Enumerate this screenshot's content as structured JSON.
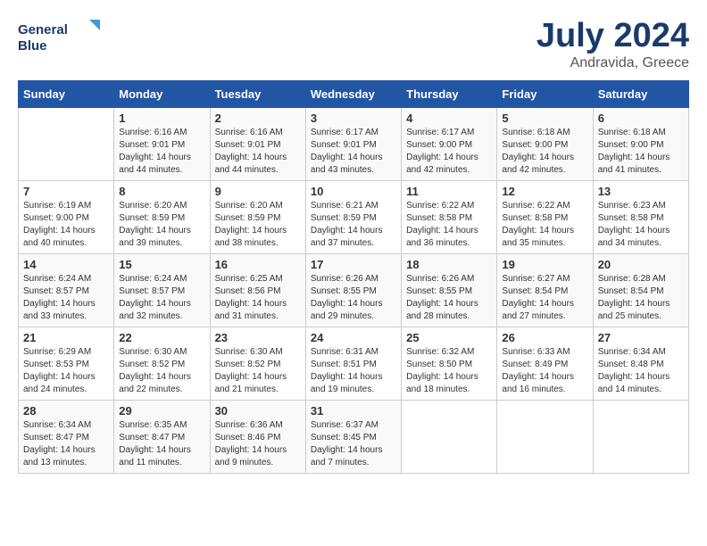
{
  "logo": {
    "line1": "General",
    "line2": "Blue"
  },
  "title": "July 2024",
  "subtitle": "Andravida, Greece",
  "days_of_week": [
    "Sunday",
    "Monday",
    "Tuesday",
    "Wednesday",
    "Thursday",
    "Friday",
    "Saturday"
  ],
  "weeks": [
    [
      {
        "day": "",
        "sunrise": "",
        "sunset": "",
        "daylight": ""
      },
      {
        "day": "1",
        "sunrise": "Sunrise: 6:16 AM",
        "sunset": "Sunset: 9:01 PM",
        "daylight": "Daylight: 14 hours and 44 minutes."
      },
      {
        "day": "2",
        "sunrise": "Sunrise: 6:16 AM",
        "sunset": "Sunset: 9:01 PM",
        "daylight": "Daylight: 14 hours and 44 minutes."
      },
      {
        "day": "3",
        "sunrise": "Sunrise: 6:17 AM",
        "sunset": "Sunset: 9:01 PM",
        "daylight": "Daylight: 14 hours and 43 minutes."
      },
      {
        "day": "4",
        "sunrise": "Sunrise: 6:17 AM",
        "sunset": "Sunset: 9:00 PM",
        "daylight": "Daylight: 14 hours and 42 minutes."
      },
      {
        "day": "5",
        "sunrise": "Sunrise: 6:18 AM",
        "sunset": "Sunset: 9:00 PM",
        "daylight": "Daylight: 14 hours and 42 minutes."
      },
      {
        "day": "6",
        "sunrise": "Sunrise: 6:18 AM",
        "sunset": "Sunset: 9:00 PM",
        "daylight": "Daylight: 14 hours and 41 minutes."
      }
    ],
    [
      {
        "day": "7",
        "sunrise": "Sunrise: 6:19 AM",
        "sunset": "Sunset: 9:00 PM",
        "daylight": "Daylight: 14 hours and 40 minutes."
      },
      {
        "day": "8",
        "sunrise": "Sunrise: 6:20 AM",
        "sunset": "Sunset: 8:59 PM",
        "daylight": "Daylight: 14 hours and 39 minutes."
      },
      {
        "day": "9",
        "sunrise": "Sunrise: 6:20 AM",
        "sunset": "Sunset: 8:59 PM",
        "daylight": "Daylight: 14 hours and 38 minutes."
      },
      {
        "day": "10",
        "sunrise": "Sunrise: 6:21 AM",
        "sunset": "Sunset: 8:59 PM",
        "daylight": "Daylight: 14 hours and 37 minutes."
      },
      {
        "day": "11",
        "sunrise": "Sunrise: 6:22 AM",
        "sunset": "Sunset: 8:58 PM",
        "daylight": "Daylight: 14 hours and 36 minutes."
      },
      {
        "day": "12",
        "sunrise": "Sunrise: 6:22 AM",
        "sunset": "Sunset: 8:58 PM",
        "daylight": "Daylight: 14 hours and 35 minutes."
      },
      {
        "day": "13",
        "sunrise": "Sunrise: 6:23 AM",
        "sunset": "Sunset: 8:58 PM",
        "daylight": "Daylight: 14 hours and 34 minutes."
      }
    ],
    [
      {
        "day": "14",
        "sunrise": "Sunrise: 6:24 AM",
        "sunset": "Sunset: 8:57 PM",
        "daylight": "Daylight: 14 hours and 33 minutes."
      },
      {
        "day": "15",
        "sunrise": "Sunrise: 6:24 AM",
        "sunset": "Sunset: 8:57 PM",
        "daylight": "Daylight: 14 hours and 32 minutes."
      },
      {
        "day": "16",
        "sunrise": "Sunrise: 6:25 AM",
        "sunset": "Sunset: 8:56 PM",
        "daylight": "Daylight: 14 hours and 31 minutes."
      },
      {
        "day": "17",
        "sunrise": "Sunrise: 6:26 AM",
        "sunset": "Sunset: 8:55 PM",
        "daylight": "Daylight: 14 hours and 29 minutes."
      },
      {
        "day": "18",
        "sunrise": "Sunrise: 6:26 AM",
        "sunset": "Sunset: 8:55 PM",
        "daylight": "Daylight: 14 hours and 28 minutes."
      },
      {
        "day": "19",
        "sunrise": "Sunrise: 6:27 AM",
        "sunset": "Sunset: 8:54 PM",
        "daylight": "Daylight: 14 hours and 27 minutes."
      },
      {
        "day": "20",
        "sunrise": "Sunrise: 6:28 AM",
        "sunset": "Sunset: 8:54 PM",
        "daylight": "Daylight: 14 hours and 25 minutes."
      }
    ],
    [
      {
        "day": "21",
        "sunrise": "Sunrise: 6:29 AM",
        "sunset": "Sunset: 8:53 PM",
        "daylight": "Daylight: 14 hours and 24 minutes."
      },
      {
        "day": "22",
        "sunrise": "Sunrise: 6:30 AM",
        "sunset": "Sunset: 8:52 PM",
        "daylight": "Daylight: 14 hours and 22 minutes."
      },
      {
        "day": "23",
        "sunrise": "Sunrise: 6:30 AM",
        "sunset": "Sunset: 8:52 PM",
        "daylight": "Daylight: 14 hours and 21 minutes."
      },
      {
        "day": "24",
        "sunrise": "Sunrise: 6:31 AM",
        "sunset": "Sunset: 8:51 PM",
        "daylight": "Daylight: 14 hours and 19 minutes."
      },
      {
        "day": "25",
        "sunrise": "Sunrise: 6:32 AM",
        "sunset": "Sunset: 8:50 PM",
        "daylight": "Daylight: 14 hours and 18 minutes."
      },
      {
        "day": "26",
        "sunrise": "Sunrise: 6:33 AM",
        "sunset": "Sunset: 8:49 PM",
        "daylight": "Daylight: 14 hours and 16 minutes."
      },
      {
        "day": "27",
        "sunrise": "Sunrise: 6:34 AM",
        "sunset": "Sunset: 8:48 PM",
        "daylight": "Daylight: 14 hours and 14 minutes."
      }
    ],
    [
      {
        "day": "28",
        "sunrise": "Sunrise: 6:34 AM",
        "sunset": "Sunset: 8:47 PM",
        "daylight": "Daylight: 14 hours and 13 minutes."
      },
      {
        "day": "29",
        "sunrise": "Sunrise: 6:35 AM",
        "sunset": "Sunset: 8:47 PM",
        "daylight": "Daylight: 14 hours and 11 minutes."
      },
      {
        "day": "30",
        "sunrise": "Sunrise: 6:36 AM",
        "sunset": "Sunset: 8:46 PM",
        "daylight": "Daylight: 14 hours and 9 minutes."
      },
      {
        "day": "31",
        "sunrise": "Sunrise: 6:37 AM",
        "sunset": "Sunset: 8:45 PM",
        "daylight": "Daylight: 14 hours and 7 minutes."
      },
      {
        "day": "",
        "sunrise": "",
        "sunset": "",
        "daylight": ""
      },
      {
        "day": "",
        "sunrise": "",
        "sunset": "",
        "daylight": ""
      },
      {
        "day": "",
        "sunrise": "",
        "sunset": "",
        "daylight": ""
      }
    ]
  ]
}
